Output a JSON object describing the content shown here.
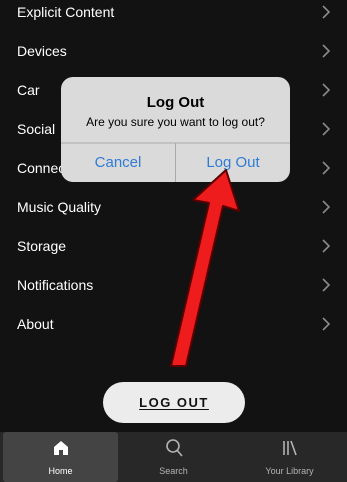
{
  "settings": {
    "items": [
      {
        "label": "Explicit Content"
      },
      {
        "label": "Devices"
      },
      {
        "label": "Car"
      },
      {
        "label": "Social"
      },
      {
        "label": "Connect to a Device"
      },
      {
        "label": "Music Quality"
      },
      {
        "label": "Storage"
      },
      {
        "label": "Notifications"
      },
      {
        "label": "About"
      }
    ]
  },
  "logout_button": {
    "label": "LOG OUT"
  },
  "dialog": {
    "title": "Log Out",
    "message": "Are you sure you want to log out?",
    "cancel_label": "Cancel",
    "confirm_label": "Log Out"
  },
  "tabbar": {
    "tabs": [
      {
        "label": "Home",
        "icon": "home-icon",
        "active": true
      },
      {
        "label": "Search",
        "icon": "search-icon",
        "active": false
      },
      {
        "label": "Your Library",
        "icon": "library-icon",
        "active": false
      }
    ]
  },
  "colors": {
    "background": "#121212",
    "dialog_bg": "#dadada",
    "ios_blue": "#2f7bd6",
    "arrow": "#ee1c1c",
    "tabbar_bg": "#282828"
  }
}
